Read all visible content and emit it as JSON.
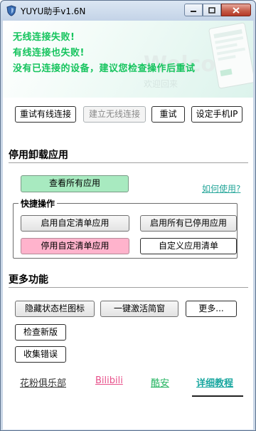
{
  "window": {
    "title": "YUYU助手v1.6N"
  },
  "banner": {
    "messages": [
      "无线连接失败!",
      "有线连接也失败!",
      "没有已连接的设备，建议您检查操作后重试"
    ],
    "welcome_text": "Welcome",
    "welcome_sub": "欢迎回来"
  },
  "top_buttons": {
    "retry_wired": "重试有线连接",
    "build_wireless": "建立无线连接",
    "retry": "重试",
    "set_phone_ip": "设定手机IP"
  },
  "uninstall": {
    "section_title": "停用卸载应用",
    "view_all": "查看所有应用",
    "how_to_use": "如何使用?",
    "quick_ops_legend": "快捷操作",
    "enable_custom": "启用自定清单应用",
    "enable_all_disabled": "启用所有已停用应用",
    "disable_custom": "停用自定清单应用",
    "custom_list": "自定义应用清单"
  },
  "more": {
    "section_title": "更多功能",
    "hide_status_icon": "隐藏状态栏图标",
    "activate_shizuku": "一键激活简窗",
    "more": "更多...",
    "check_update": "检查新版",
    "collect_errors": "收集错误"
  },
  "footer_links": [
    {
      "label": "花粉俱乐部",
      "color": "#333333"
    },
    {
      "label": "Bilibili",
      "color": "#e8508a"
    },
    {
      "label": "酷安",
      "color": "#22b35f"
    },
    {
      "label": "详细教程",
      "color": "#1aa7a0"
    }
  ]
}
